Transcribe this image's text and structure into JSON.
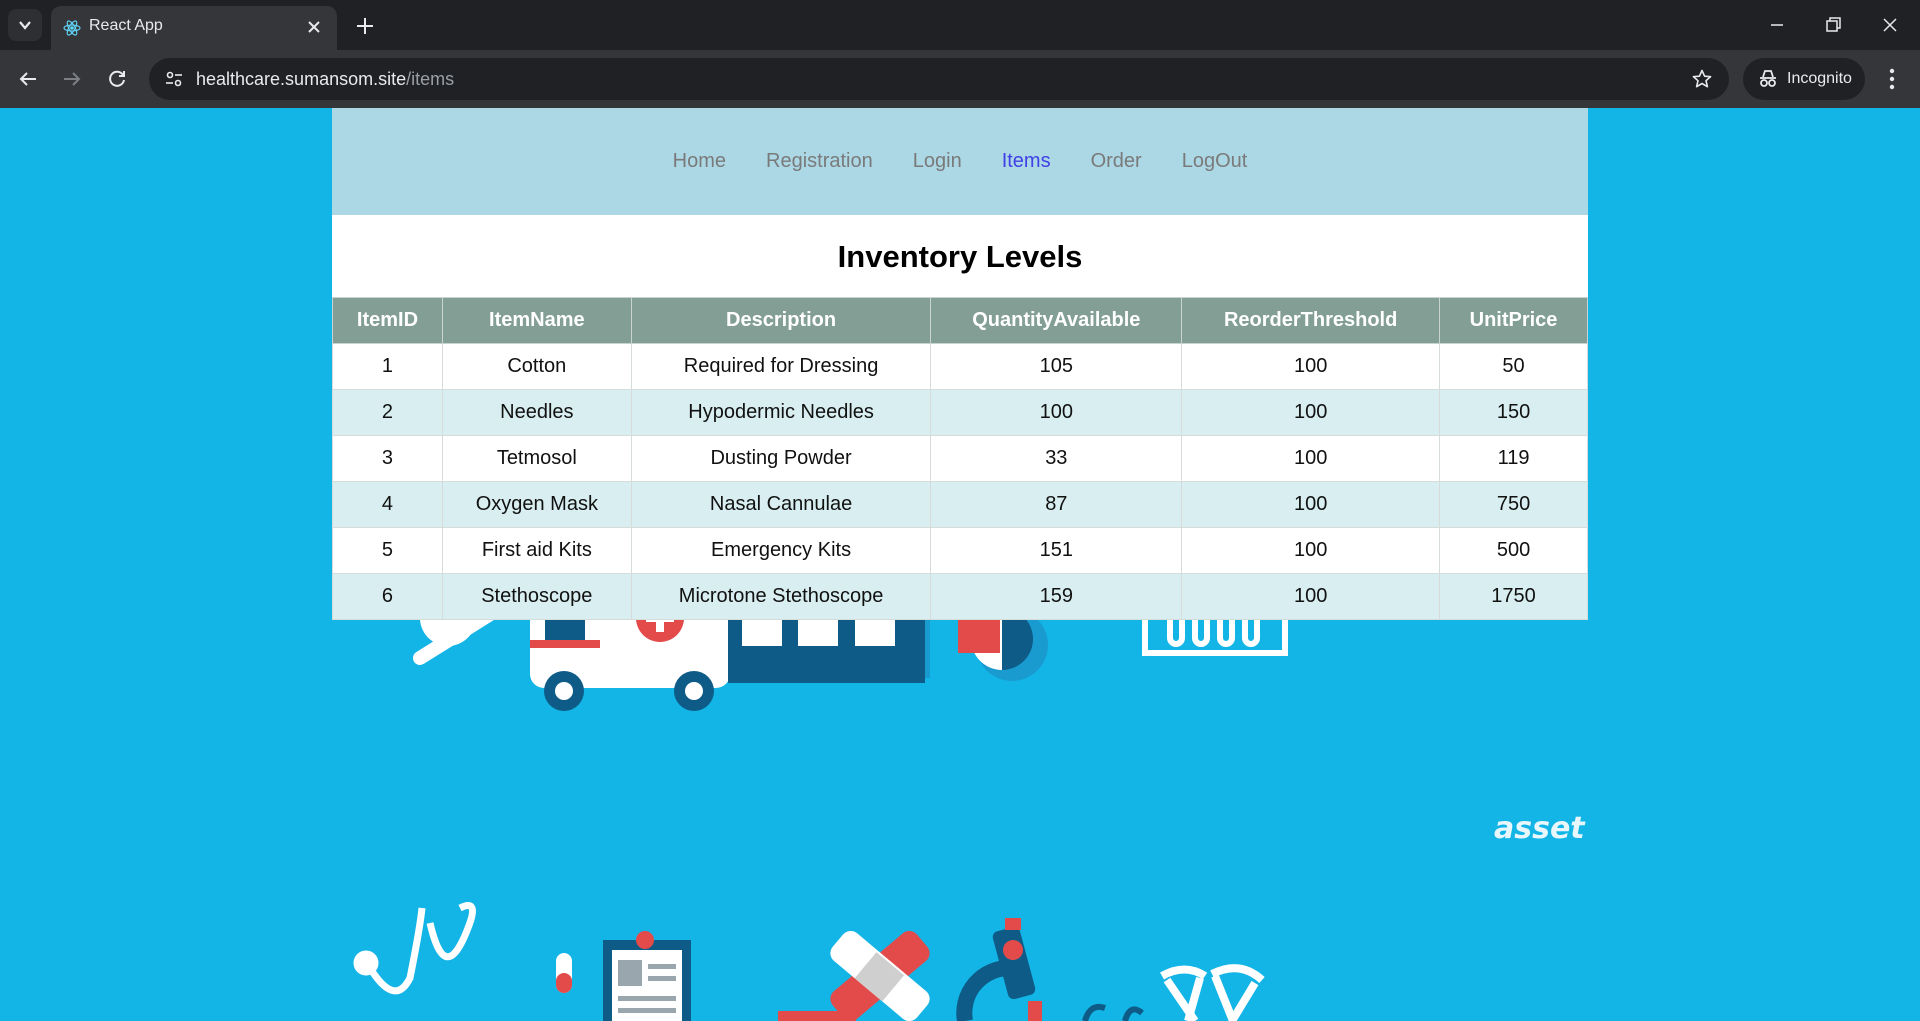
{
  "browser": {
    "tab_title": "React App",
    "url_host": "healthcare.sumansom.site",
    "url_path": "/items",
    "incognito_label": "Incognito"
  },
  "nav": {
    "links": [
      "Home",
      "Registration",
      "Login",
      "Items",
      "Order",
      "LogOut"
    ],
    "active": "Items",
    "bg_color": "#acd8e6",
    "active_color": "#4040e6"
  },
  "page": {
    "heading": "Inventory Levels",
    "background_color": "#13b4e6",
    "watermark": "asset"
  },
  "table": {
    "header_color": "#839f95",
    "columns": [
      "ItemID",
      "ItemName",
      "Description",
      "QuantityAvailable",
      "ReorderThreshold",
      "UnitPrice"
    ],
    "rows": [
      [
        "1",
        "Cotton",
        "Required for Dressing",
        "105",
        "100",
        "50"
      ],
      [
        "2",
        "Needles",
        "Hypodermic Needles",
        "100",
        "100",
        "150"
      ],
      [
        "3",
        "Tetmosol",
        "Dusting Powder",
        "33",
        "100",
        "119"
      ],
      [
        "4",
        "Oxygen Mask",
        "Nasal Cannulae",
        "87",
        "100",
        "750"
      ],
      [
        "5",
        "First aid Kits",
        "Emergency Kits",
        "151",
        "100",
        "500"
      ],
      [
        "6",
        "Stethoscope",
        "Microtone Stethoscope",
        "159",
        "100",
        "1750"
      ]
    ]
  }
}
